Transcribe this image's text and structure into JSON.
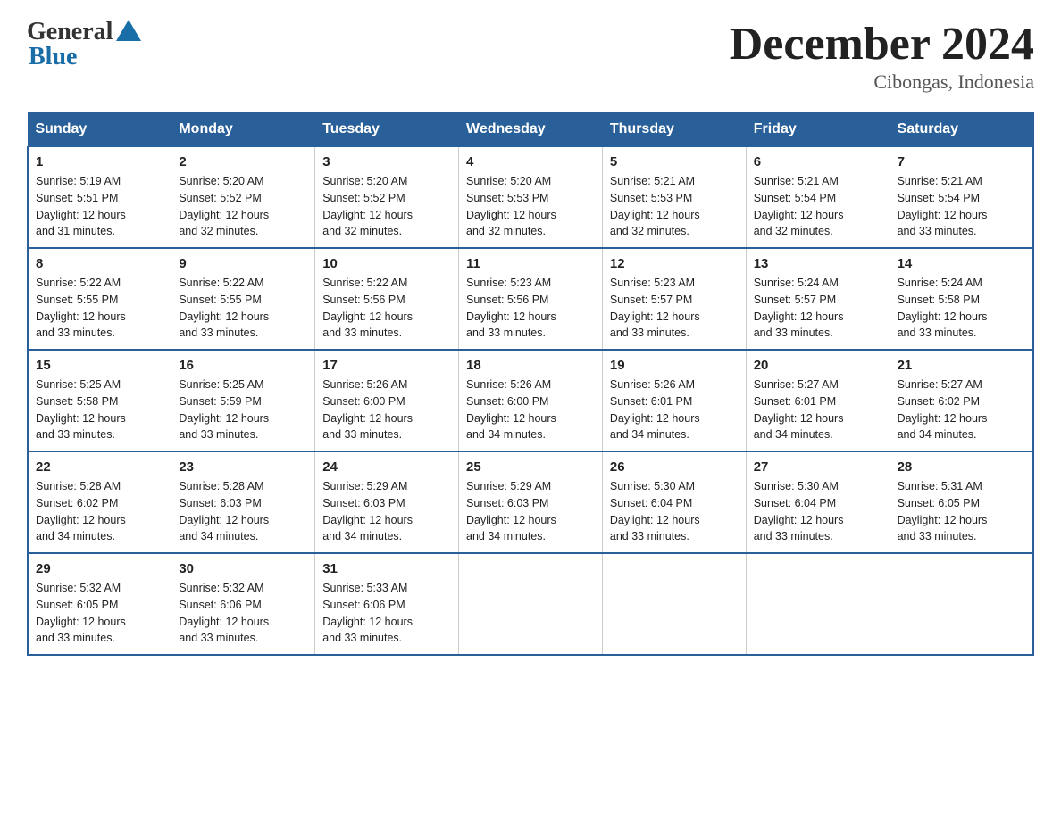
{
  "logo": {
    "general": "General",
    "blue": "Blue"
  },
  "title": "December 2024",
  "location": "Cibongas, Indonesia",
  "days_header": [
    "Sunday",
    "Monday",
    "Tuesday",
    "Wednesday",
    "Thursday",
    "Friday",
    "Saturday"
  ],
  "weeks": [
    [
      {
        "day": "1",
        "sunrise": "5:19 AM",
        "sunset": "5:51 PM",
        "daylight": "12 hours and 31 minutes."
      },
      {
        "day": "2",
        "sunrise": "5:20 AM",
        "sunset": "5:52 PM",
        "daylight": "12 hours and 32 minutes."
      },
      {
        "day": "3",
        "sunrise": "5:20 AM",
        "sunset": "5:52 PM",
        "daylight": "12 hours and 32 minutes."
      },
      {
        "day": "4",
        "sunrise": "5:20 AM",
        "sunset": "5:53 PM",
        "daylight": "12 hours and 32 minutes."
      },
      {
        "day": "5",
        "sunrise": "5:21 AM",
        "sunset": "5:53 PM",
        "daylight": "12 hours and 32 minutes."
      },
      {
        "day": "6",
        "sunrise": "5:21 AM",
        "sunset": "5:54 PM",
        "daylight": "12 hours and 32 minutes."
      },
      {
        "day": "7",
        "sunrise": "5:21 AM",
        "sunset": "5:54 PM",
        "daylight": "12 hours and 33 minutes."
      }
    ],
    [
      {
        "day": "8",
        "sunrise": "5:22 AM",
        "sunset": "5:55 PM",
        "daylight": "12 hours and 33 minutes."
      },
      {
        "day": "9",
        "sunrise": "5:22 AM",
        "sunset": "5:55 PM",
        "daylight": "12 hours and 33 minutes."
      },
      {
        "day": "10",
        "sunrise": "5:22 AM",
        "sunset": "5:56 PM",
        "daylight": "12 hours and 33 minutes."
      },
      {
        "day": "11",
        "sunrise": "5:23 AM",
        "sunset": "5:56 PM",
        "daylight": "12 hours and 33 minutes."
      },
      {
        "day": "12",
        "sunrise": "5:23 AM",
        "sunset": "5:57 PM",
        "daylight": "12 hours and 33 minutes."
      },
      {
        "day": "13",
        "sunrise": "5:24 AM",
        "sunset": "5:57 PM",
        "daylight": "12 hours and 33 minutes."
      },
      {
        "day": "14",
        "sunrise": "5:24 AM",
        "sunset": "5:58 PM",
        "daylight": "12 hours and 33 minutes."
      }
    ],
    [
      {
        "day": "15",
        "sunrise": "5:25 AM",
        "sunset": "5:58 PM",
        "daylight": "12 hours and 33 minutes."
      },
      {
        "day": "16",
        "sunrise": "5:25 AM",
        "sunset": "5:59 PM",
        "daylight": "12 hours and 33 minutes."
      },
      {
        "day": "17",
        "sunrise": "5:26 AM",
        "sunset": "6:00 PM",
        "daylight": "12 hours and 33 minutes."
      },
      {
        "day": "18",
        "sunrise": "5:26 AM",
        "sunset": "6:00 PM",
        "daylight": "12 hours and 34 minutes."
      },
      {
        "day": "19",
        "sunrise": "5:26 AM",
        "sunset": "6:01 PM",
        "daylight": "12 hours and 34 minutes."
      },
      {
        "day": "20",
        "sunrise": "5:27 AM",
        "sunset": "6:01 PM",
        "daylight": "12 hours and 34 minutes."
      },
      {
        "day": "21",
        "sunrise": "5:27 AM",
        "sunset": "6:02 PM",
        "daylight": "12 hours and 34 minutes."
      }
    ],
    [
      {
        "day": "22",
        "sunrise": "5:28 AM",
        "sunset": "6:02 PM",
        "daylight": "12 hours and 34 minutes."
      },
      {
        "day": "23",
        "sunrise": "5:28 AM",
        "sunset": "6:03 PM",
        "daylight": "12 hours and 34 minutes."
      },
      {
        "day": "24",
        "sunrise": "5:29 AM",
        "sunset": "6:03 PM",
        "daylight": "12 hours and 34 minutes."
      },
      {
        "day": "25",
        "sunrise": "5:29 AM",
        "sunset": "6:03 PM",
        "daylight": "12 hours and 34 minutes."
      },
      {
        "day": "26",
        "sunrise": "5:30 AM",
        "sunset": "6:04 PM",
        "daylight": "12 hours and 33 minutes."
      },
      {
        "day": "27",
        "sunrise": "5:30 AM",
        "sunset": "6:04 PM",
        "daylight": "12 hours and 33 minutes."
      },
      {
        "day": "28",
        "sunrise": "5:31 AM",
        "sunset": "6:05 PM",
        "daylight": "12 hours and 33 minutes."
      }
    ],
    [
      {
        "day": "29",
        "sunrise": "5:32 AM",
        "sunset": "6:05 PM",
        "daylight": "12 hours and 33 minutes."
      },
      {
        "day": "30",
        "sunrise": "5:32 AM",
        "sunset": "6:06 PM",
        "daylight": "12 hours and 33 minutes."
      },
      {
        "day": "31",
        "sunrise": "5:33 AM",
        "sunset": "6:06 PM",
        "daylight": "12 hours and 33 minutes."
      },
      {
        "day": "",
        "sunrise": "",
        "sunset": "",
        "daylight": ""
      },
      {
        "day": "",
        "sunrise": "",
        "sunset": "",
        "daylight": ""
      },
      {
        "day": "",
        "sunrise": "",
        "sunset": "",
        "daylight": ""
      },
      {
        "day": "",
        "sunrise": "",
        "sunset": "",
        "daylight": ""
      }
    ]
  ],
  "labels": {
    "sunrise_prefix": "Sunrise: ",
    "sunset_prefix": "Sunset: ",
    "daylight_prefix": "Daylight: "
  }
}
